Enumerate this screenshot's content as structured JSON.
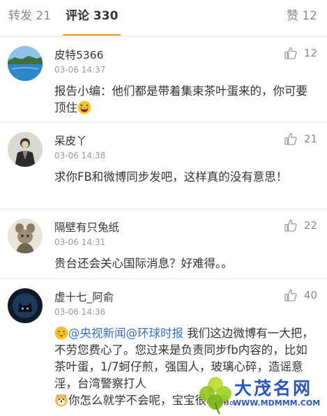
{
  "tabs": {
    "repost": "转发 21",
    "comments": "评论 330",
    "likes": "赞 12"
  },
  "comments": [
    {
      "user": "皮特5366",
      "time": "03-06 14:37",
      "likes": "12",
      "text": "报告小编：他们都是带着集束茶叶蛋来的，你可要顶住",
      "avatar": "lake-avatar"
    },
    {
      "user": "呆皮丫",
      "time": "03-06 14:38",
      "likes": "21",
      "text": "求你FB和微博同步发吧，这样真的没有意思！",
      "avatar": "robed-figure-avatar"
    },
    {
      "user": "隔壁有只兔纸",
      "time": "03-06 14:31",
      "likes": "22",
      "text": "贵台还会关心国际消息？好难得。。",
      "avatar": "mouse-figurine-avatar"
    },
    {
      "user": "虚十七_阿俞",
      "time": "03-06 14:36",
      "likes": "40",
      "mention1": "@央视新闻",
      "mention2": "@环球时报",
      "text_a": " 我们这边微博有一大把，不劳您费心了。您过来是负责同步fb内容的，比如茶叶蛋，1/7蚵仔煎，强国人，玻璃心碎，造谣意淫，台湾警察打人",
      "text_b": "你怎么就学不会呢，宝宝很心痛。",
      "avatar": "cat-avatar"
    }
  ],
  "watermark": {
    "title": "大茂名网",
    "url": "WWW.MDMMM.COM"
  },
  "colors": {
    "accent": "#f28a1e",
    "mention": "#3a6fb0",
    "watermark": "#2c55b8"
  }
}
